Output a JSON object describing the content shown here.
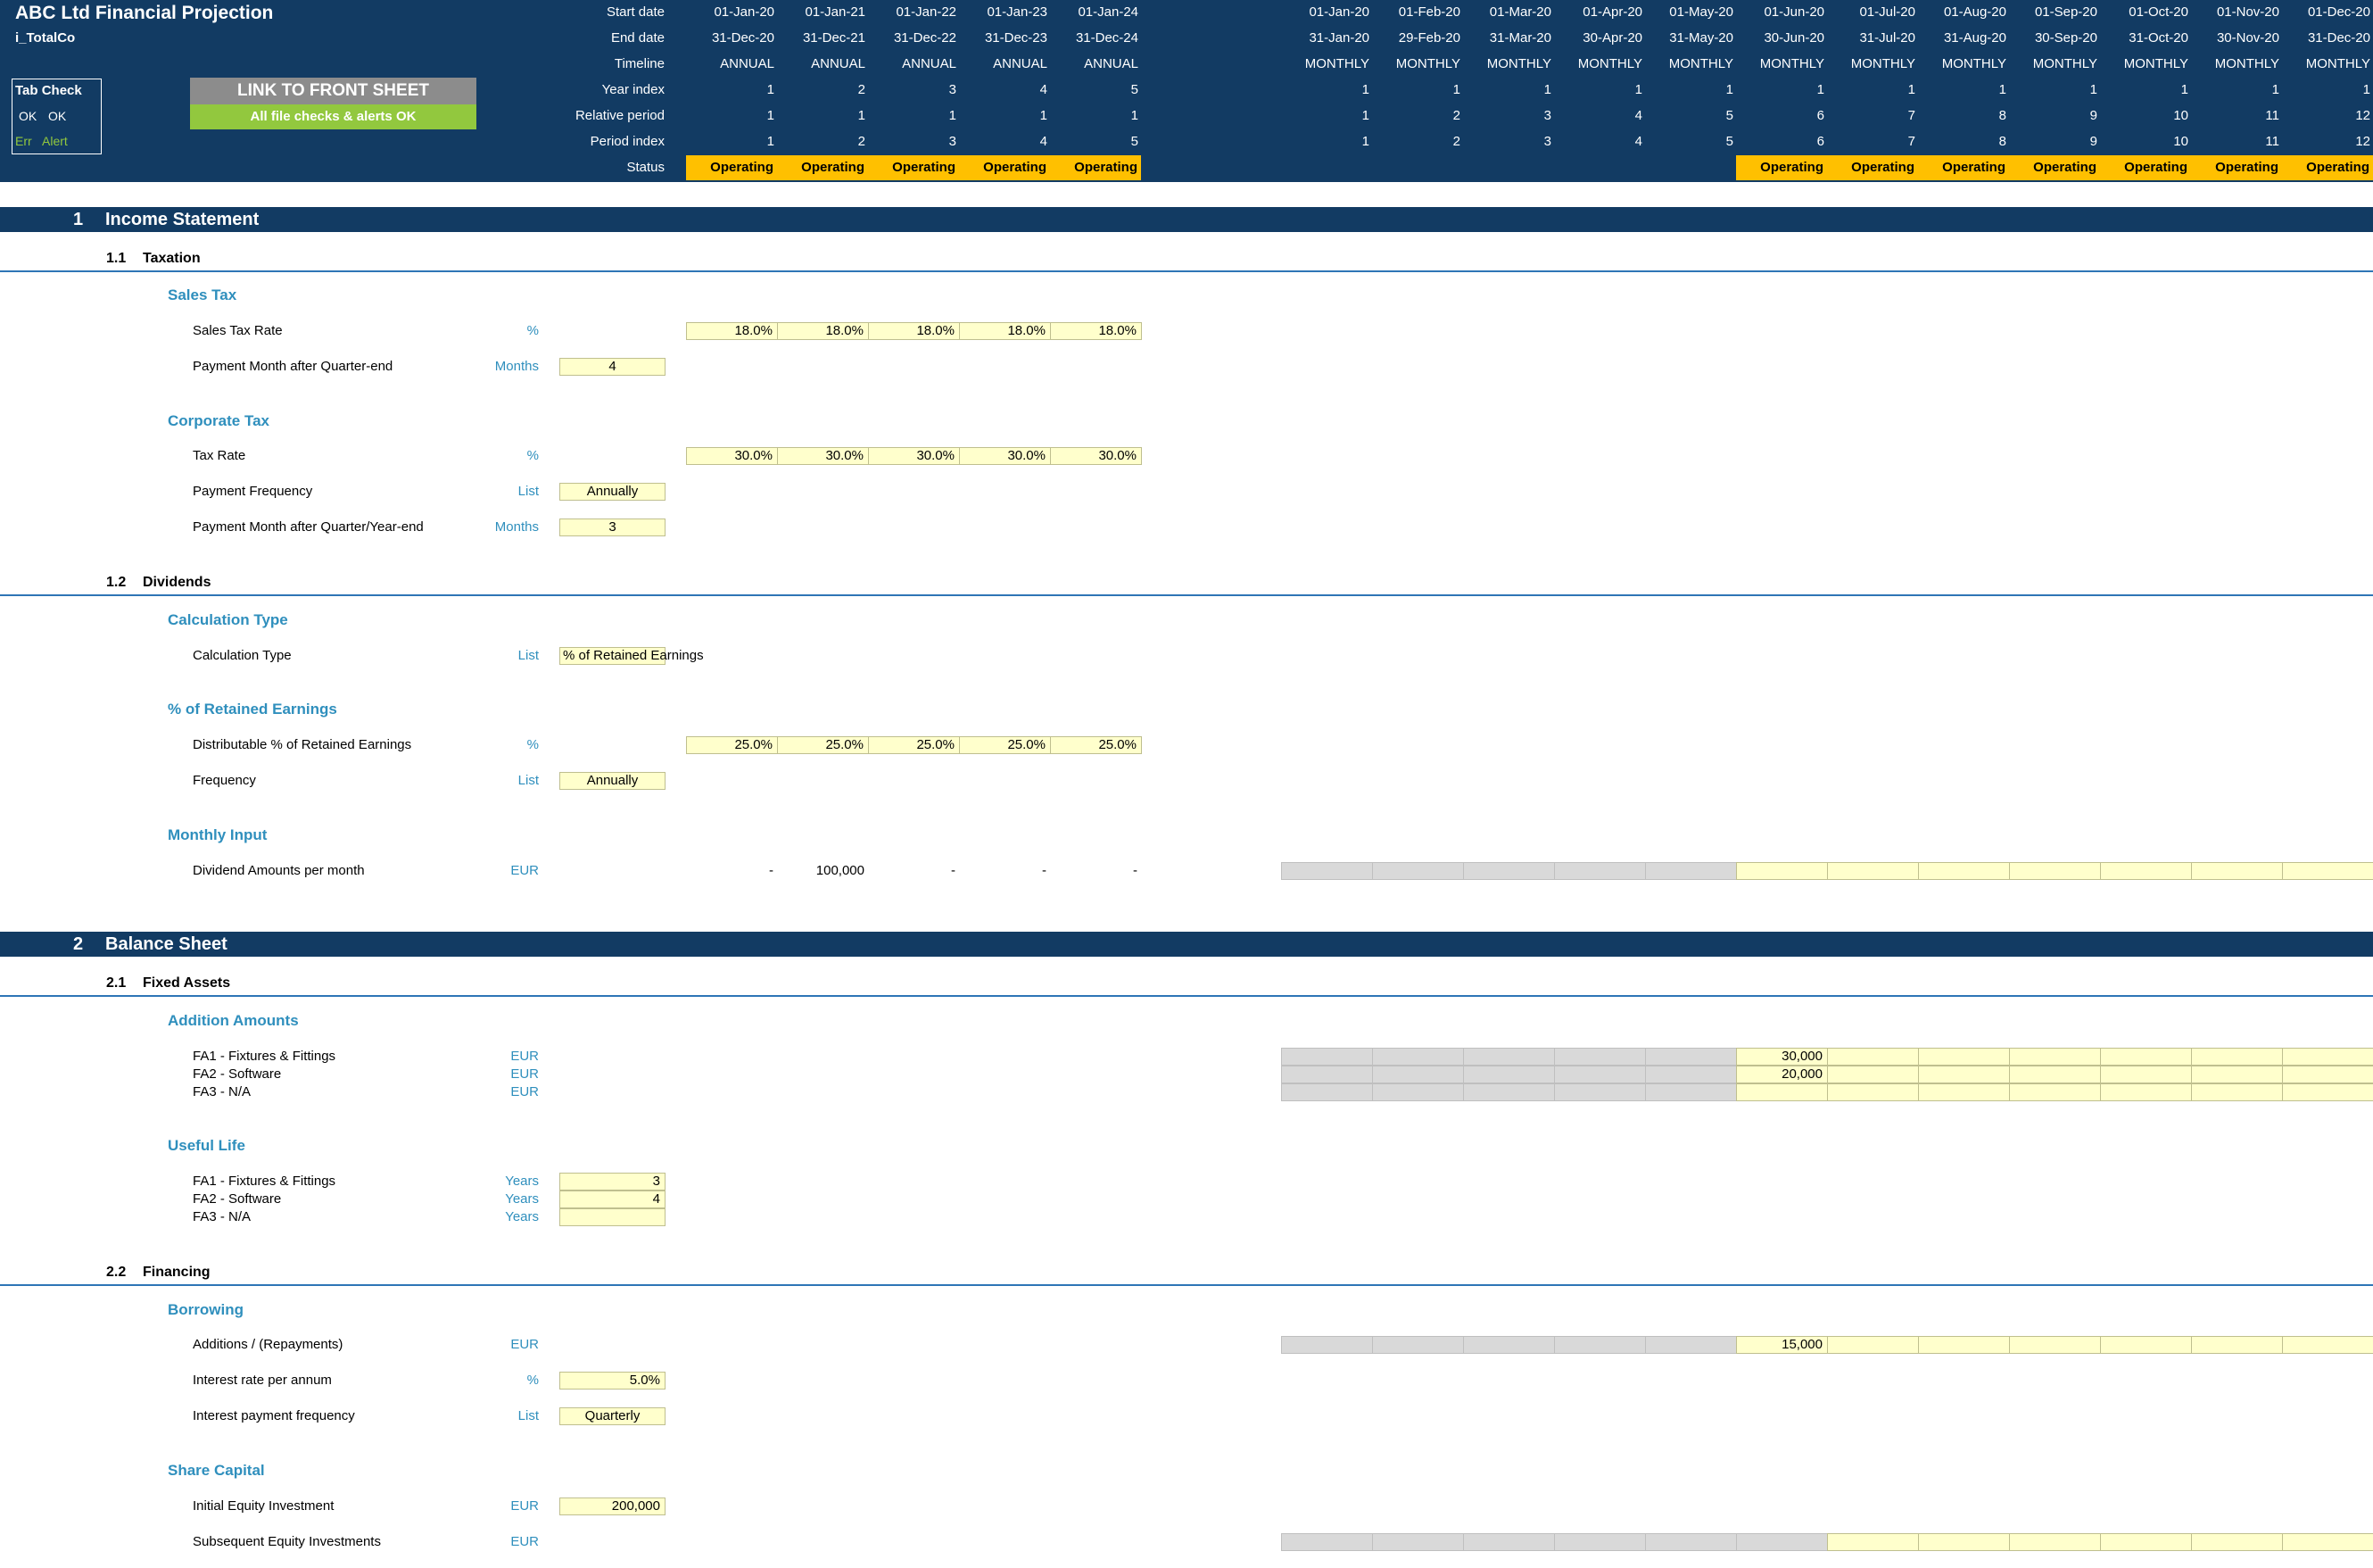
{
  "header": {
    "title": "ABC Ltd Financial Projection",
    "sheet_name": "i_TotalCo",
    "tab_check": {
      "title": "Tab Check",
      "row1": [
        "OK",
        "OK"
      ],
      "row2": [
        "Err",
        "Alert"
      ]
    },
    "link_button": "LINK TO FRONT SHEET",
    "checks_status": "All file checks & alerts OK",
    "row_labels": [
      "Start date",
      "End date",
      "Timeline",
      "Year index",
      "Relative period",
      "Period index",
      "Status"
    ],
    "annual": {
      "start": [
        "01-Jan-20",
        "01-Jan-21",
        "01-Jan-22",
        "01-Jan-23",
        "01-Jan-24"
      ],
      "end": [
        "31-Dec-20",
        "31-Dec-21",
        "31-Dec-22",
        "31-Dec-23",
        "31-Dec-24"
      ],
      "timeline": [
        "ANNUAL",
        "ANNUAL",
        "ANNUAL",
        "ANNUAL",
        "ANNUAL"
      ],
      "year_index": [
        "1",
        "2",
        "3",
        "4",
        "5"
      ],
      "relative_period": [
        "1",
        "1",
        "1",
        "1",
        "1"
      ],
      "period_index": [
        "1",
        "2",
        "3",
        "4",
        "5"
      ],
      "status": [
        "Operating",
        "Operating",
        "Operating",
        "Operating",
        "Operating"
      ]
    },
    "monthly": {
      "start": [
        "01-Jan-20",
        "01-Feb-20",
        "01-Mar-20",
        "01-Apr-20",
        "01-May-20",
        "01-Jun-20",
        "01-Jul-20",
        "01-Aug-20",
        "01-Sep-20",
        "01-Oct-20",
        "01-Nov-20",
        "01-Dec-20"
      ],
      "end": [
        "31-Jan-20",
        "29-Feb-20",
        "31-Mar-20",
        "30-Apr-20",
        "31-May-20",
        "30-Jun-20",
        "31-Jul-20",
        "31-Aug-20",
        "30-Sep-20",
        "31-Oct-20",
        "30-Nov-20",
        "31-Dec-20"
      ],
      "timeline": [
        "MONTHLY",
        "MONTHLY",
        "MONTHLY",
        "MONTHLY",
        "MONTHLY",
        "MONTHLY",
        "MONTHLY",
        "MONTHLY",
        "MONTHLY",
        "MONTHLY",
        "MONTHLY",
        "MONTHLY"
      ],
      "year_index": [
        "1",
        "1",
        "1",
        "1",
        "1",
        "1",
        "1",
        "1",
        "1",
        "1",
        "1",
        "1"
      ],
      "relative_period": [
        "1",
        "2",
        "3",
        "4",
        "5",
        "6",
        "7",
        "8",
        "9",
        "10",
        "11",
        "12"
      ],
      "period_index": [
        "1",
        "2",
        "3",
        "4",
        "5",
        "6",
        "7",
        "8",
        "9",
        "10",
        "11",
        "12"
      ],
      "status": [
        "",
        "",
        "",
        "",
        "",
        "Operating",
        "Operating",
        "Operating",
        "Operating",
        "Operating",
        "Operating",
        "Operating"
      ]
    }
  },
  "income": {
    "section": {
      "num": "1",
      "title": "Income Statement"
    },
    "taxation": {
      "num": "1.1",
      "title": "Taxation"
    },
    "sales_tax": {
      "group": "Sales Tax",
      "rate": {
        "label": "Sales Tax Rate",
        "unit": "%",
        "values": [
          "18.0%",
          "18.0%",
          "18.0%",
          "18.0%",
          "18.0%"
        ]
      },
      "payment_month": {
        "label": "Payment Month after Quarter-end",
        "unit": "Months",
        "value": "4"
      }
    },
    "corporate_tax": {
      "group": "Corporate Tax",
      "rate": {
        "label": "Tax Rate",
        "unit": "%",
        "values": [
          "30.0%",
          "30.0%",
          "30.0%",
          "30.0%",
          "30.0%"
        ]
      },
      "frequency": {
        "label": "Payment Frequency",
        "unit": "List",
        "value": "Annually"
      },
      "payment_month": {
        "label": "Payment Month after Quarter/Year-end",
        "unit": "Months",
        "value": "3"
      }
    },
    "dividends": {
      "num": "1.2",
      "title": "Dividends"
    },
    "calc_type": {
      "group": "Calculation Type",
      "label": "Calculation Type",
      "unit": "List",
      "value": "% of Retained Earnings"
    },
    "retained": {
      "group": "% of Retained Earnings",
      "distributable": {
        "label": "Distributable % of Retained Earnings",
        "unit": "%",
        "values": [
          "25.0%",
          "25.0%",
          "25.0%",
          "25.0%",
          "25.0%"
        ]
      },
      "frequency": {
        "label": "Frequency",
        "unit": "List",
        "value": "Annually"
      }
    },
    "monthly_input": {
      "group": "Monthly Input",
      "label": "Dividend Amounts per month",
      "unit": "EUR",
      "annual": [
        "-",
        "100,000",
        "-",
        "-",
        "-"
      ]
    }
  },
  "balance": {
    "section": {
      "num": "2",
      "title": "Balance Sheet"
    },
    "fixed_assets": {
      "num": "2.1",
      "title": "Fixed Assets"
    },
    "additions": {
      "group": "Addition Amounts",
      "rows": [
        {
          "label": "FA1 - Fixtures & Fittings",
          "unit": "EUR",
          "jun": "30,000"
        },
        {
          "label": "FA2 - Software",
          "unit": "EUR",
          "jun": "20,000"
        },
        {
          "label": "FA3 - N/A",
          "unit": "EUR",
          "jun": ""
        }
      ]
    },
    "useful_life": {
      "group": "Useful Life",
      "rows": [
        {
          "label": "FA1 - Fixtures & Fittings",
          "unit": "Years",
          "value": "3"
        },
        {
          "label": "FA2 - Software",
          "unit": "Years",
          "value": "4"
        },
        {
          "label": "FA3 - N/A",
          "unit": "Years",
          "value": ""
        }
      ]
    },
    "financing": {
      "num": "2.2",
      "title": "Financing"
    },
    "borrowing": {
      "group": "Borrowing",
      "additions": {
        "label": "Additions / (Repayments)",
        "unit": "EUR",
        "jun": "15,000"
      },
      "interest_rate": {
        "label": "Interest rate per annum",
        "unit": "%",
        "value": "5.0%"
      },
      "interest_freq": {
        "label": "Interest payment frequency",
        "unit": "List",
        "value": "Quarterly"
      }
    },
    "share_capital": {
      "group": "Share Capital",
      "initial": {
        "label": "Initial Equity Investment",
        "unit": "EUR",
        "value": "200,000"
      },
      "subsequent": {
        "label": "Subsequent Equity Investments",
        "unit": "EUR"
      }
    }
  }
}
